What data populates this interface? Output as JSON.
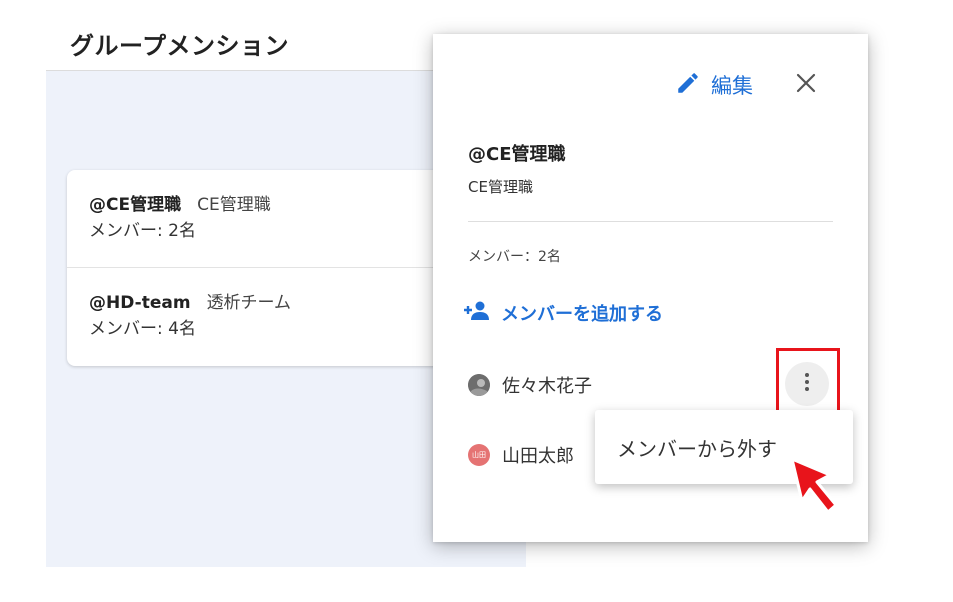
{
  "page": {
    "title": "グループメンション"
  },
  "groups": [
    {
      "mention": "@CE管理職",
      "name": "CE管理職",
      "members": "メンバー: 2名"
    },
    {
      "mention": "@HD-team",
      "name": "透析チーム",
      "members": "メンバー: 4名"
    }
  ],
  "panel": {
    "edit_label": "編集",
    "mention": "@CE管理職",
    "group_name": "CE管理職",
    "member_count": "メンバー：2名",
    "add_member_label": "メンバーを追加する",
    "members": [
      {
        "name": "佐々木花子",
        "avatar": "photo-avatar"
      },
      {
        "name": "山田太郎",
        "avatar": "山田"
      }
    ],
    "menu_item": "メンバーから外す"
  },
  "colors": {
    "accent": "#1f6fd6",
    "highlight": "#e8141b",
    "background": "#eef2fa"
  },
  "icons": [
    "pencil-icon",
    "close-icon",
    "add-person-icon",
    "more-vert-icon",
    "cursor-arrow-icon"
  ]
}
